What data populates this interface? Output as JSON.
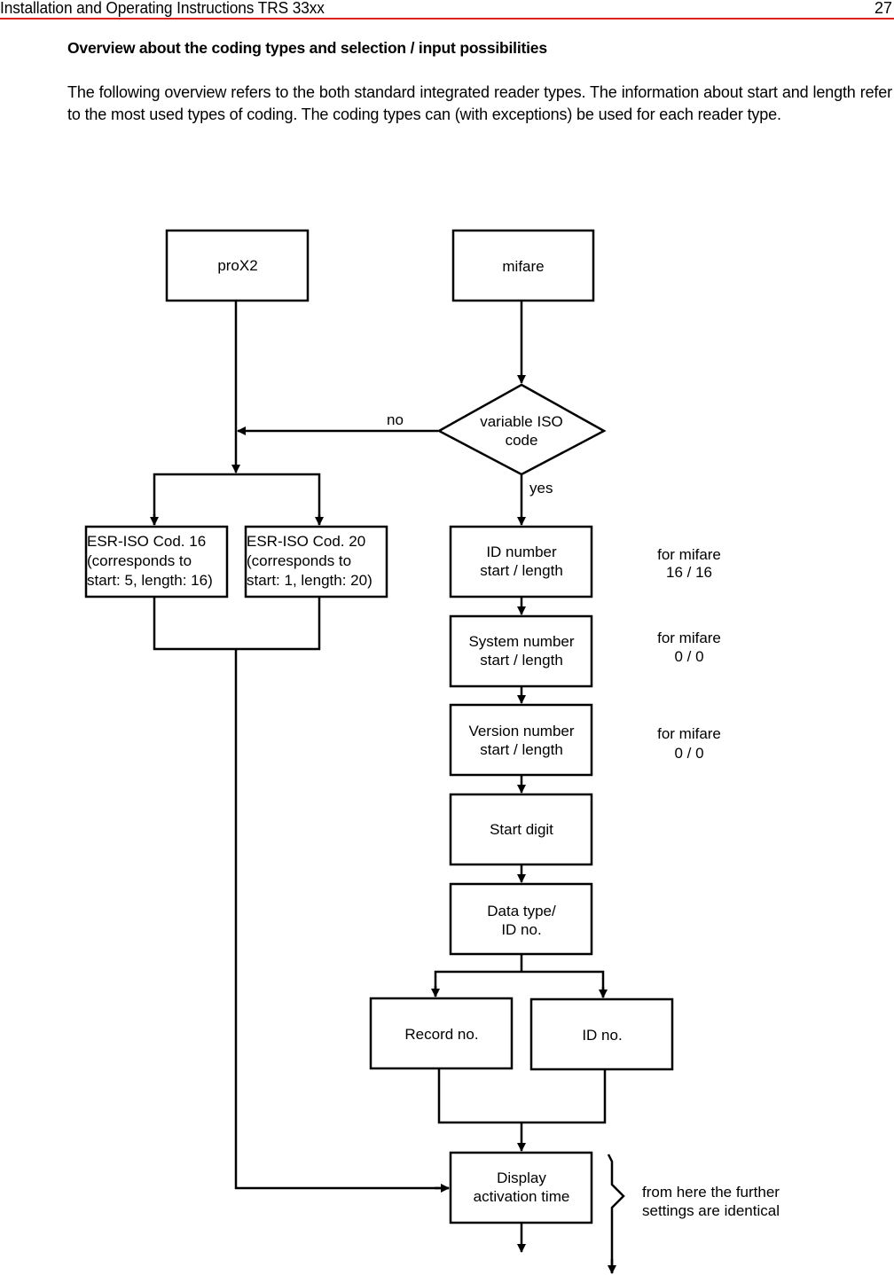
{
  "header": {
    "title": "Installation and Operating Instructions TRS 33xx",
    "page_number": "27",
    "accent_color": "#e0201c"
  },
  "heading": "Overview about the coding types and selection / input possibilities",
  "paragraph": "The following overview refers to the both standard integrated reader types. The information about start and length refer to the most used types of coding. The coding types can (with exceptions) be used for each reader type.",
  "flowchart": {
    "prox2": "proX2",
    "mifare": "mifare",
    "decision": {
      "line1": "variable ISO",
      "line2": "code"
    },
    "no_label": "no",
    "yes_label": "yes",
    "esr16": {
      "line1": "ESR-ISO Cod. 16",
      "line2": "(corresponds to",
      "line3": "start: 5, length: 16)"
    },
    "esr20": {
      "line1": "ESR-ISO Cod. 20",
      "line2": "(corresponds to",
      "line3": "start: 1, length: 20)"
    },
    "id_number": {
      "line1": "ID number",
      "line2": "start / length"
    },
    "system_number": {
      "line1": "System number",
      "line2": "start / length"
    },
    "version_number": {
      "line1": "Version number",
      "line2": "start / length"
    },
    "start_digit": "Start digit",
    "data_type": {
      "line1": "Data type/",
      "line2": "ID no."
    },
    "record_no": "Record no.",
    "id_no": "ID no.",
    "display": {
      "line1": "Display",
      "line2": "activation time"
    },
    "note_id": {
      "line1": "for mifare",
      "line2": "16 / 16"
    },
    "note_system": {
      "line1": "for mifare",
      "line2": "0 / 0"
    },
    "note_version": {
      "line1": "for mifare",
      "line2": "0 / 0"
    },
    "note_further": {
      "line1": "from here the further",
      "line2": "settings are identical"
    }
  }
}
